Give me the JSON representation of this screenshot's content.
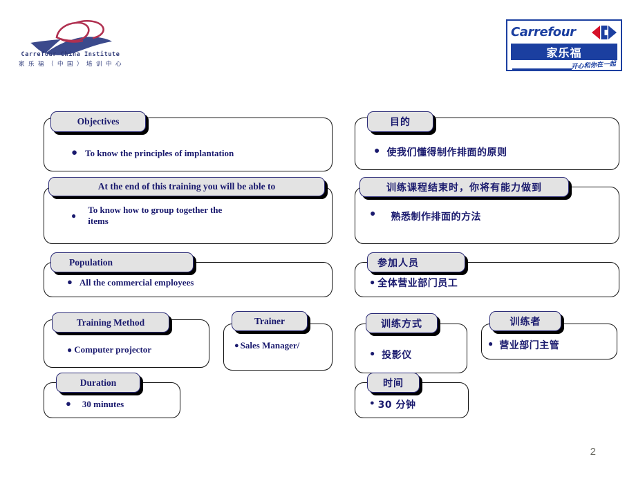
{
  "branding": {
    "left_logo": {
      "name": "carrefour-china-institute-logo",
      "english": "Carrefour China Institute",
      "chinese": "家 乐 福 （ 中 国 ） 培 训 中 心"
    },
    "right_logo": {
      "name": "carrefour-logo",
      "wordmark": "Carrefour",
      "chinese": "家乐福",
      "slogan": "开心和你在一起"
    }
  },
  "slide": {
    "page_number": "2",
    "colors": {
      "text_navy": "#1a1a6e",
      "header_fill": "#e3e3e3",
      "header_border": "#2b2b77",
      "body_border": "#111111",
      "brand_blue": "#1b3fa0",
      "brand_red": "#d6122a",
      "page_number_gray": "#6b6b63"
    },
    "cards": [
      {
        "id": "objectives",
        "lang": "en",
        "header": "Objectives",
        "items": [
          "To know the principles  of implantation"
        ]
      },
      {
        "id": "objectives-cn",
        "lang": "cn",
        "header": "目的",
        "items": [
          "使我们懂得制作排面的原则"
        ]
      },
      {
        "id": "end-of-training",
        "lang": "en",
        "header": "At the end of this training  you will  be able to",
        "items": [
          "To know how to group together the items"
        ]
      },
      {
        "id": "end-of-training-cn",
        "lang": "cn",
        "header": "训练课程结束时，你将有能力做到",
        "items": [
          "熟悉制作排面的方法"
        ]
      },
      {
        "id": "population",
        "lang": "en",
        "header": "Population",
        "items": [
          "All the commercial employees"
        ]
      },
      {
        "id": "population-cn",
        "lang": "cn",
        "header": "参加人员",
        "items": [
          "全体营业部门员工"
        ]
      },
      {
        "id": "training-method",
        "lang": "en",
        "header": "Training  Method",
        "items": [
          "Computer projector"
        ]
      },
      {
        "id": "trainer",
        "lang": "en",
        "header": "Trainer",
        "items": [
          "Sales Manager/"
        ]
      },
      {
        "id": "training-method-cn",
        "lang": "cn",
        "header": "训练方式",
        "items": [
          "投影仪"
        ]
      },
      {
        "id": "trainer-cn",
        "lang": "cn",
        "header": "训练者",
        "items": [
          "营业部门主管"
        ]
      },
      {
        "id": "duration",
        "lang": "en",
        "header": "Duration",
        "items": [
          "30 minutes"
        ]
      },
      {
        "id": "duration-cn",
        "lang": "cn",
        "header": "时间",
        "items": [
          "30 分钟"
        ]
      }
    ]
  }
}
